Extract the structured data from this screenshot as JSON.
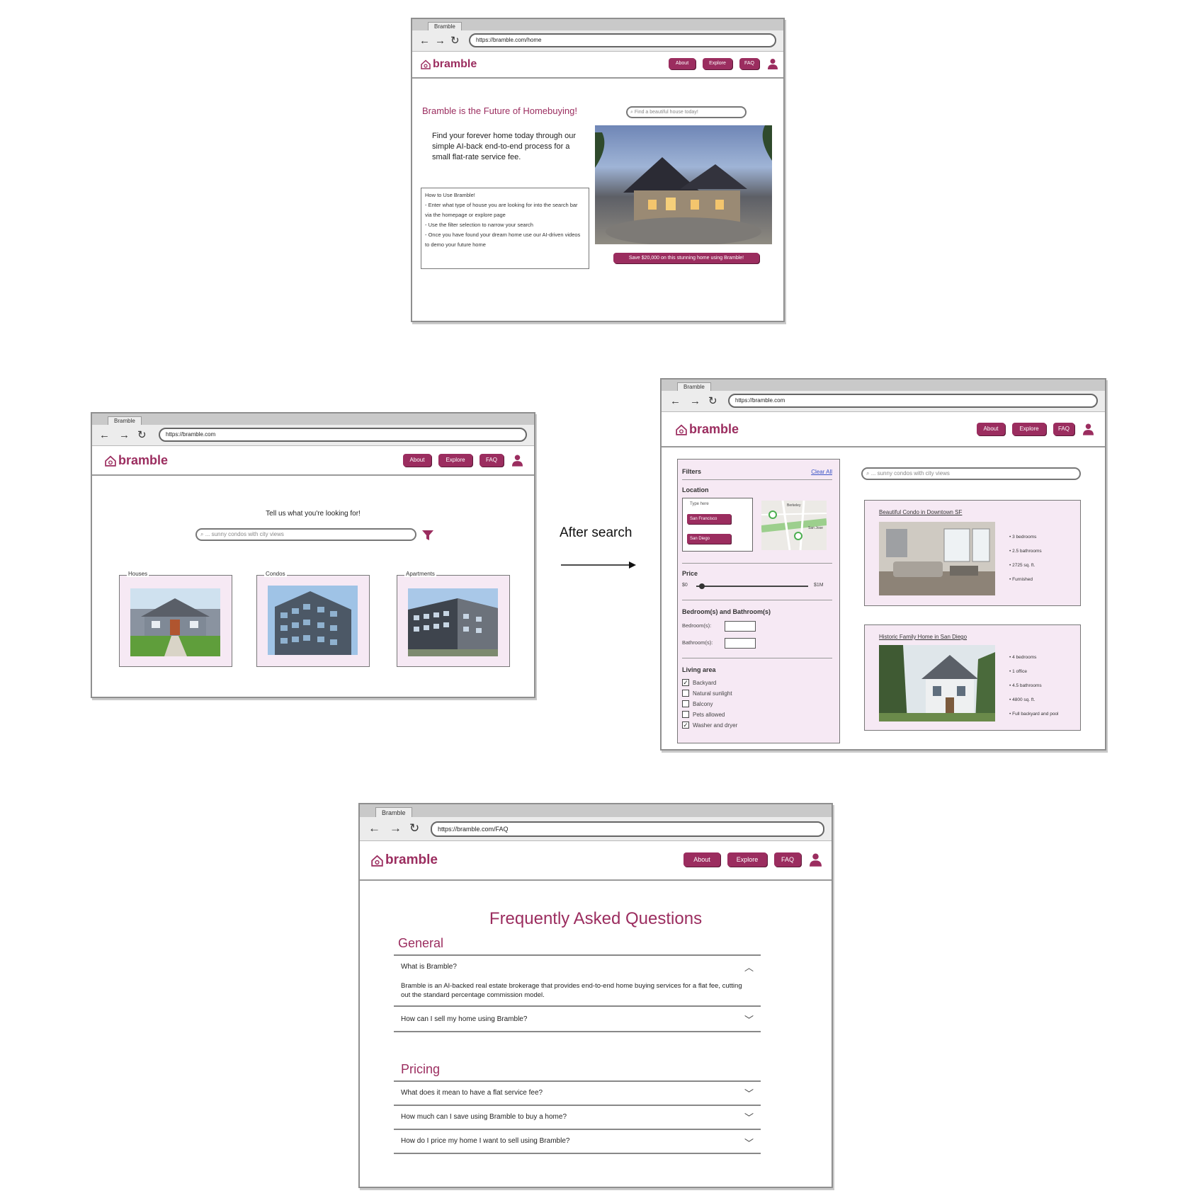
{
  "brand": {
    "name": "bramble",
    "tab_title": "Bramble",
    "accent_color": "#9b2d5f",
    "tint_color": "#f6e9f4"
  },
  "nav": {
    "about": "About",
    "explore": "Explore",
    "faq": "FAQ",
    "user_icon": "user-icon",
    "back_icon": "arrow-left-icon",
    "forward_icon": "arrow-right-icon",
    "reload_icon": "reload-icon"
  },
  "home": {
    "url": "https://bramble.com/home",
    "headline": "Bramble is the Future of Homebuying!",
    "search_placeholder": "Find a beautiful house today!",
    "intro": "Find your forever home today through our simple AI-back end-to-end process for a small flat-rate service fee.",
    "howto_title": "How to Use Bramble!",
    "howto_lines": [
      "- Enter what type of house you are looking for into the search bar via the homepage or explore page",
      "- Use the filter selection to narrow your search",
      "- Once you have found your dream home use our AI-driven videos to demo your future home"
    ],
    "cta": "Save $20,000 on this stunning home using Bramble!"
  },
  "explore": {
    "url": "https://bramble.com",
    "prompt": "Tell us what you're looking for!",
    "search_value": "... sunny condos with city views",
    "categories": [
      "Houses",
      "Condos",
      "Apartments"
    ]
  },
  "flow_label": "After search",
  "results": {
    "url": "https://bramble.com",
    "search_value": "... sunny condos with city views",
    "filters": {
      "title": "Filters",
      "clear": "Clear All",
      "location_label": "Location",
      "location_mini_label": "Type here",
      "location_chips": [
        "San Francisco",
        "San Diego"
      ],
      "map_labels": [
        "Berkeley",
        "San Jose"
      ],
      "price_label": "Price",
      "price_min": "$0",
      "price_max": "$1M",
      "price_level": 0.05,
      "bed_bath_label": "Bedroom(s) and Bathroom(s)",
      "bedrooms_label": "Bedroom(s):",
      "bathrooms_label": "Bathroom(s):",
      "living_label": "Living area",
      "living_options": [
        {
          "label": "Backyard",
          "checked": true
        },
        {
          "label": "Natural sunlight",
          "checked": false
        },
        {
          "label": "Balcony",
          "checked": false
        },
        {
          "label": "Pets allowed",
          "checked": false
        },
        {
          "label": "Washer and dryer",
          "checked": true
        }
      ]
    },
    "listings": [
      {
        "title": "Beautiful Condo in Downtown SF",
        "features": [
          "3 bedrooms",
          "2.5 bathrooms",
          "2725 sq. ft.",
          "Furnished"
        ]
      },
      {
        "title": "Historic Family Home in San Diego",
        "features": [
          "4 bedrooms",
          "1 office",
          "4.5 bathrooms",
          "4800 sq. ft.",
          "Full backyard and pool"
        ]
      }
    ]
  },
  "faq": {
    "url": "https://bramble.com/FAQ",
    "title": "Frequently Asked Questions",
    "sections": [
      {
        "heading": "General",
        "items": [
          {
            "q": "What is Bramble?",
            "a": "Bramble is an AI-backed real estate brokerage that provides end-to-end home buying services for a flat fee, cutting out the standard percentage commission model.",
            "expanded": true
          },
          {
            "q": "How can I sell my home using Bramble?",
            "expanded": false
          }
        ]
      },
      {
        "heading": "Pricing",
        "items": [
          {
            "q": "What does it mean to have a flat service fee?",
            "expanded": false
          },
          {
            "q": "How much can I save using Bramble to buy a home?",
            "expanded": false
          },
          {
            "q": "How do I price my home I want to sell using Bramble?",
            "expanded": false
          }
        ]
      }
    ]
  }
}
